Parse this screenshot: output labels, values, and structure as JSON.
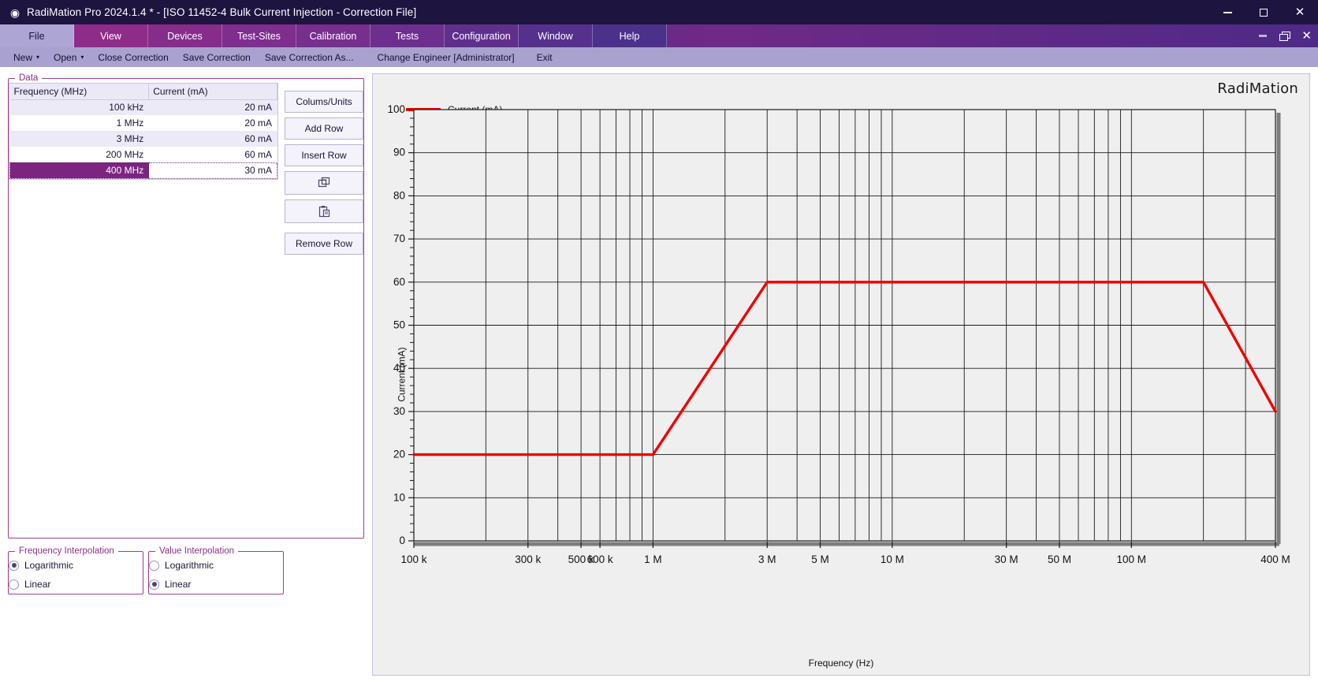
{
  "window": {
    "title": "RadiMation Pro 2024.1.4 * - [ISO 11452-4 Bulk Current Injection - Correction File]",
    "app_icon": "radimation-logo-icon",
    "minimize": "—",
    "maximize": "□",
    "close": "✕"
  },
  "ribbon": {
    "tabs": [
      {
        "label": "File",
        "active": true
      },
      {
        "label": "View",
        "active": false
      },
      {
        "label": "Devices",
        "active": false
      },
      {
        "label": "Test-Sites",
        "active": false
      },
      {
        "label": "Calibration",
        "active": false
      },
      {
        "label": "Tests",
        "active": false
      },
      {
        "label": "Configuration",
        "active": false
      },
      {
        "label": "Window",
        "active": false
      },
      {
        "label": "Help",
        "active": false
      }
    ],
    "mdi_minimize": "—",
    "mdi_restore": "❐",
    "mdi_close": "✕"
  },
  "file_menu": {
    "items": [
      {
        "label": "New",
        "caret": "▾"
      },
      {
        "label": "Open",
        "caret": "▾"
      },
      {
        "label": "Close Correction",
        "caret": ""
      },
      {
        "label": "Save Correction",
        "caret": ""
      },
      {
        "label": "Save Correction As...",
        "caret": ""
      },
      {
        "label": "Change Engineer [Administrator]",
        "caret": ""
      },
      {
        "label": "Exit",
        "caret": ""
      }
    ]
  },
  "data_panel": {
    "legend": "Data",
    "columns": [
      "Frequency (MHz)",
      "Current (mA)"
    ],
    "rows": [
      {
        "frequency": "100 kHz",
        "current": "20 mA",
        "selected": false
      },
      {
        "frequency": "1 MHz",
        "current": "20 mA",
        "selected": false
      },
      {
        "frequency": "3 MHz",
        "current": "60 mA",
        "selected": false
      },
      {
        "frequency": "200 MHz",
        "current": "60 mA",
        "selected": false
      },
      {
        "frequency": "400 MHz",
        "current": "30 mA",
        "selected": true
      }
    ],
    "buttons": {
      "columns_units": "Colums/Units",
      "add_row": "Add Row",
      "insert_row": "Insert Row",
      "copy": "",
      "paste": "",
      "remove_row": "Remove Row"
    }
  },
  "frequency_interpolation": {
    "legend": "Frequency Interpolation",
    "options": [
      {
        "label": "Logarithmic",
        "selected": true
      },
      {
        "label": "Linear",
        "selected": false
      }
    ]
  },
  "value_interpolation": {
    "legend": "Value Interpolation",
    "options": [
      {
        "label": "Logarithmic",
        "selected": false
      },
      {
        "label": "Linear",
        "selected": true
      }
    ]
  },
  "chart_panel": {
    "brand": "RadiMation"
  },
  "chart_data": {
    "type": "line",
    "title": "",
    "xlabel": "Frequency (Hz)",
    "ylabel": "Current (mA)",
    "xscale": "log",
    "yscale": "linear",
    "xlim": [
      100000,
      400000000
    ],
    "ylim": [
      0,
      100
    ],
    "grid": true,
    "legend_position": "top-left",
    "accent_color": "#f20000",
    "plot_background": "#efefef",
    "yticks": [
      0,
      10,
      20,
      30,
      40,
      50,
      60,
      70,
      80,
      90,
      100
    ],
    "ytick_labels": [
      "0",
      "10",
      "20",
      "30",
      "40",
      "50",
      "60",
      "70",
      "80",
      "90",
      "100"
    ],
    "xticks": [
      100000,
      300000,
      500000,
      600000,
      1000000,
      3000000,
      5000000,
      10000000,
      30000000,
      50000000,
      100000000,
      400000000
    ],
    "xtick_labels": [
      "100 k",
      "300 k",
      "500 k",
      "600 k",
      "1 M",
      "3 M",
      "5 M",
      "10 M",
      "30 M",
      "50 M",
      "100 M",
      "400 M"
    ],
    "series": [
      {
        "name": "Current (mA)",
        "color": "#f20000",
        "x": [
          100000,
          1000000,
          3000000,
          200000000,
          400000000
        ],
        "y": [
          20,
          20,
          60,
          60,
          30
        ]
      }
    ]
  }
}
